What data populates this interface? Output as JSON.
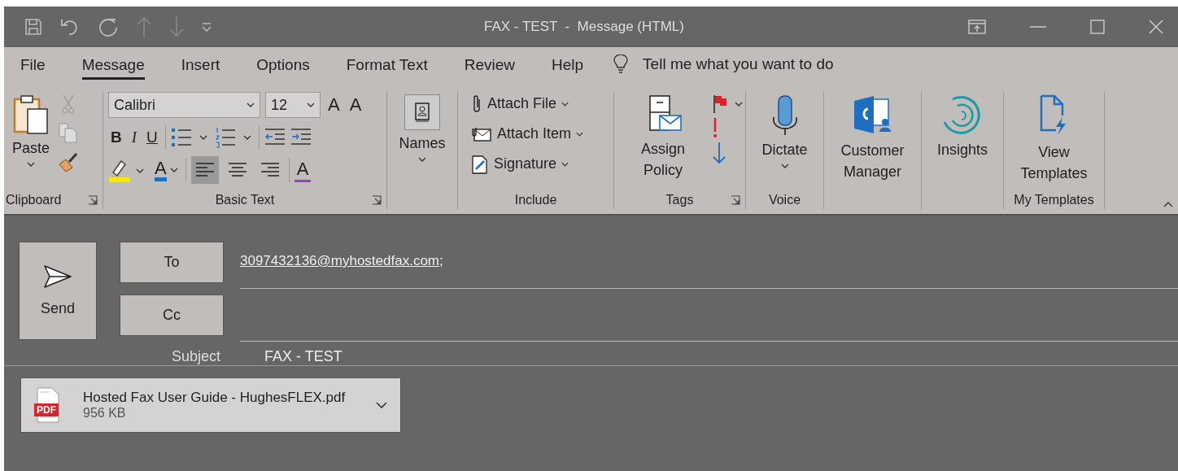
{
  "window": {
    "title": "FAX - TEST  -  Message (HTML)"
  },
  "tabs": [
    {
      "label": "File",
      "selected": false
    },
    {
      "label": "Message",
      "selected": true
    },
    {
      "label": "Insert",
      "selected": false
    },
    {
      "label": "Options",
      "selected": false
    },
    {
      "label": "Format Text",
      "selected": false
    },
    {
      "label": "Review",
      "selected": false
    },
    {
      "label": "Help",
      "selected": false
    }
  ],
  "tell_me": {
    "placeholder": "Tell me what you want to do"
  },
  "groups": [
    {
      "kind": "clipboard",
      "label": "Clipboard",
      "launcher": true,
      "paste": "Paste"
    },
    {
      "kind": "basic_text",
      "label": "Basic Text",
      "launcher": true,
      "font": "Calibri",
      "size": "12",
      "grow": "A",
      "shrink": "A",
      "bold": "B",
      "italic": "I",
      "underline": "U",
      "font_color": "A",
      "clear": "A",
      "alignments": [
        {
          "selected": true
        },
        {
          "selected": false
        },
        {
          "selected": false
        }
      ]
    },
    {
      "kind": "names",
      "launcher": false,
      "button": "Names"
    },
    {
      "kind": "include",
      "label": "Include",
      "launcher": false,
      "items": [
        "Attach File",
        "Attach Item",
        "Signature"
      ]
    },
    {
      "kind": "tags",
      "label": "Tags",
      "launcher": true,
      "button": "Assign Policy"
    },
    {
      "kind": "voice",
      "label": "Voice",
      "launcher": false,
      "button": "Dictate"
    },
    {
      "kind": "customer",
      "launcher": false,
      "button": "Customer Manager"
    },
    {
      "kind": "insights",
      "launcher": false,
      "button": "Insights"
    },
    {
      "kind": "templates",
      "label": "My Templates",
      "launcher": false,
      "button": "View Templates"
    }
  ],
  "compose": {
    "send": "Send",
    "to": "To",
    "cc": "Cc",
    "to_value": "3097432136@myhostedfax.com;",
    "subject_label": "Subject",
    "subject": "FAX - TEST"
  },
  "attachment": {
    "badge": "PDF",
    "name": "Hosted Fax User Guide - HughesFLEX.pdf",
    "size": "956 KB"
  }
}
